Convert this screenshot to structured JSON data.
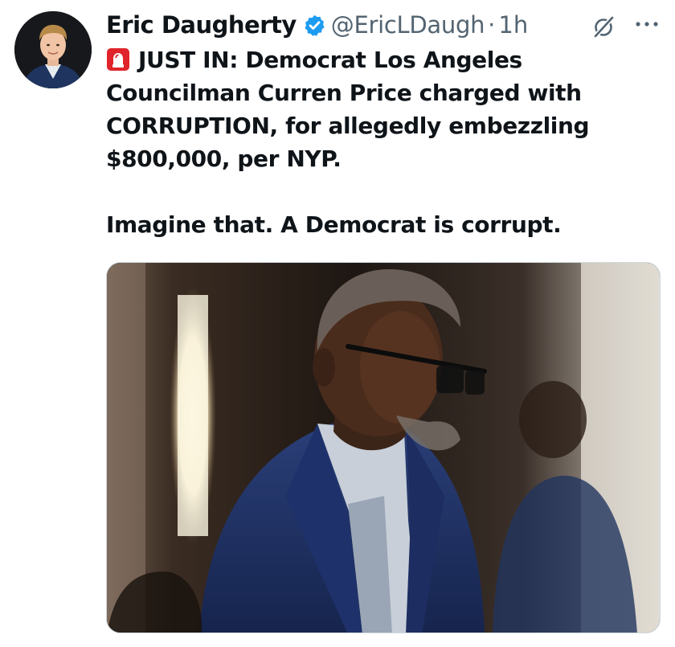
{
  "author": {
    "display_name": "Eric Daugherty",
    "handle": "@EricLDaugh",
    "separator": "·",
    "timestamp": "1h",
    "verified": true
  },
  "icons": {
    "verified": "verified-badge-icon",
    "grok": "grok-icon",
    "more": "more-options-icon",
    "siren": "police-siren-emoji"
  },
  "tweet": {
    "line1": "JUST IN: Democrat Los Angeles Councilman Curren Price charged with CORRUPTION, for allegedly embezzling $800,000, per NYP.",
    "line2": "Imagine that. A Democrat is corrupt."
  },
  "colors": {
    "verified_blue": "#1d9bf0",
    "secondary_text": "#536471",
    "primary_text": "#0f1419"
  }
}
